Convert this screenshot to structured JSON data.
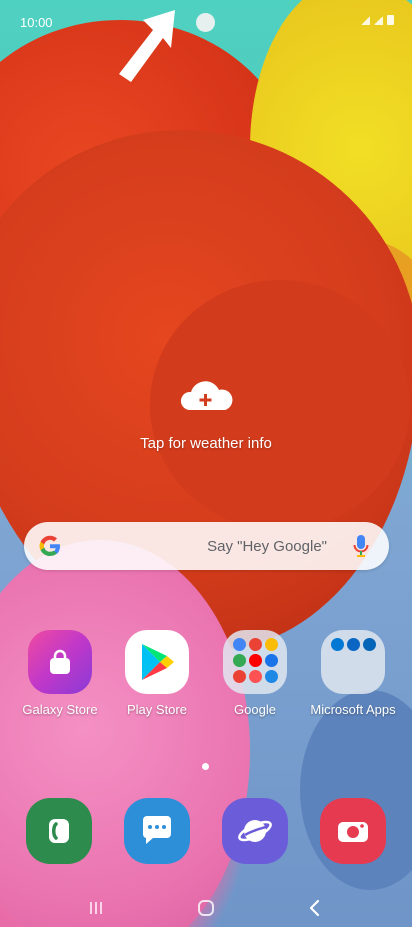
{
  "status_bar": {
    "time": "10:00",
    "icons": [
      "signal-icon",
      "signal-icon",
      "battery-icon"
    ]
  },
  "weather": {
    "icon": "cloud-add-icon",
    "label": "Tap for weather info"
  },
  "search": {
    "icon": "google-g-icon",
    "hint": "Say \"Hey Google\"",
    "mic_icon": "mic-icon"
  },
  "apps": [
    {
      "label": "Galaxy Store",
      "icon": "shopping-bag-icon"
    },
    {
      "label": "Play Store",
      "icon": "play-store-icon"
    },
    {
      "label": "Google",
      "icon": "folder-icon"
    },
    {
      "label": "Microsoft Apps",
      "icon": "folder-icon"
    }
  ],
  "dock": [
    {
      "name": "phone",
      "icon": "phone-icon"
    },
    {
      "name": "messages",
      "icon": "chat-bubble-icon"
    },
    {
      "name": "internet",
      "icon": "planet-icon"
    },
    {
      "name": "camera",
      "icon": "camera-icon"
    }
  ],
  "nav": [
    "recent-apps-icon",
    "home-icon",
    "back-icon"
  ],
  "colors": {
    "phone": "#2d8c4d",
    "messages": "#2d8fd8",
    "internet": "#6b5dd9",
    "camera": "#e53a4f",
    "galaxy_store": "#c038c9"
  }
}
